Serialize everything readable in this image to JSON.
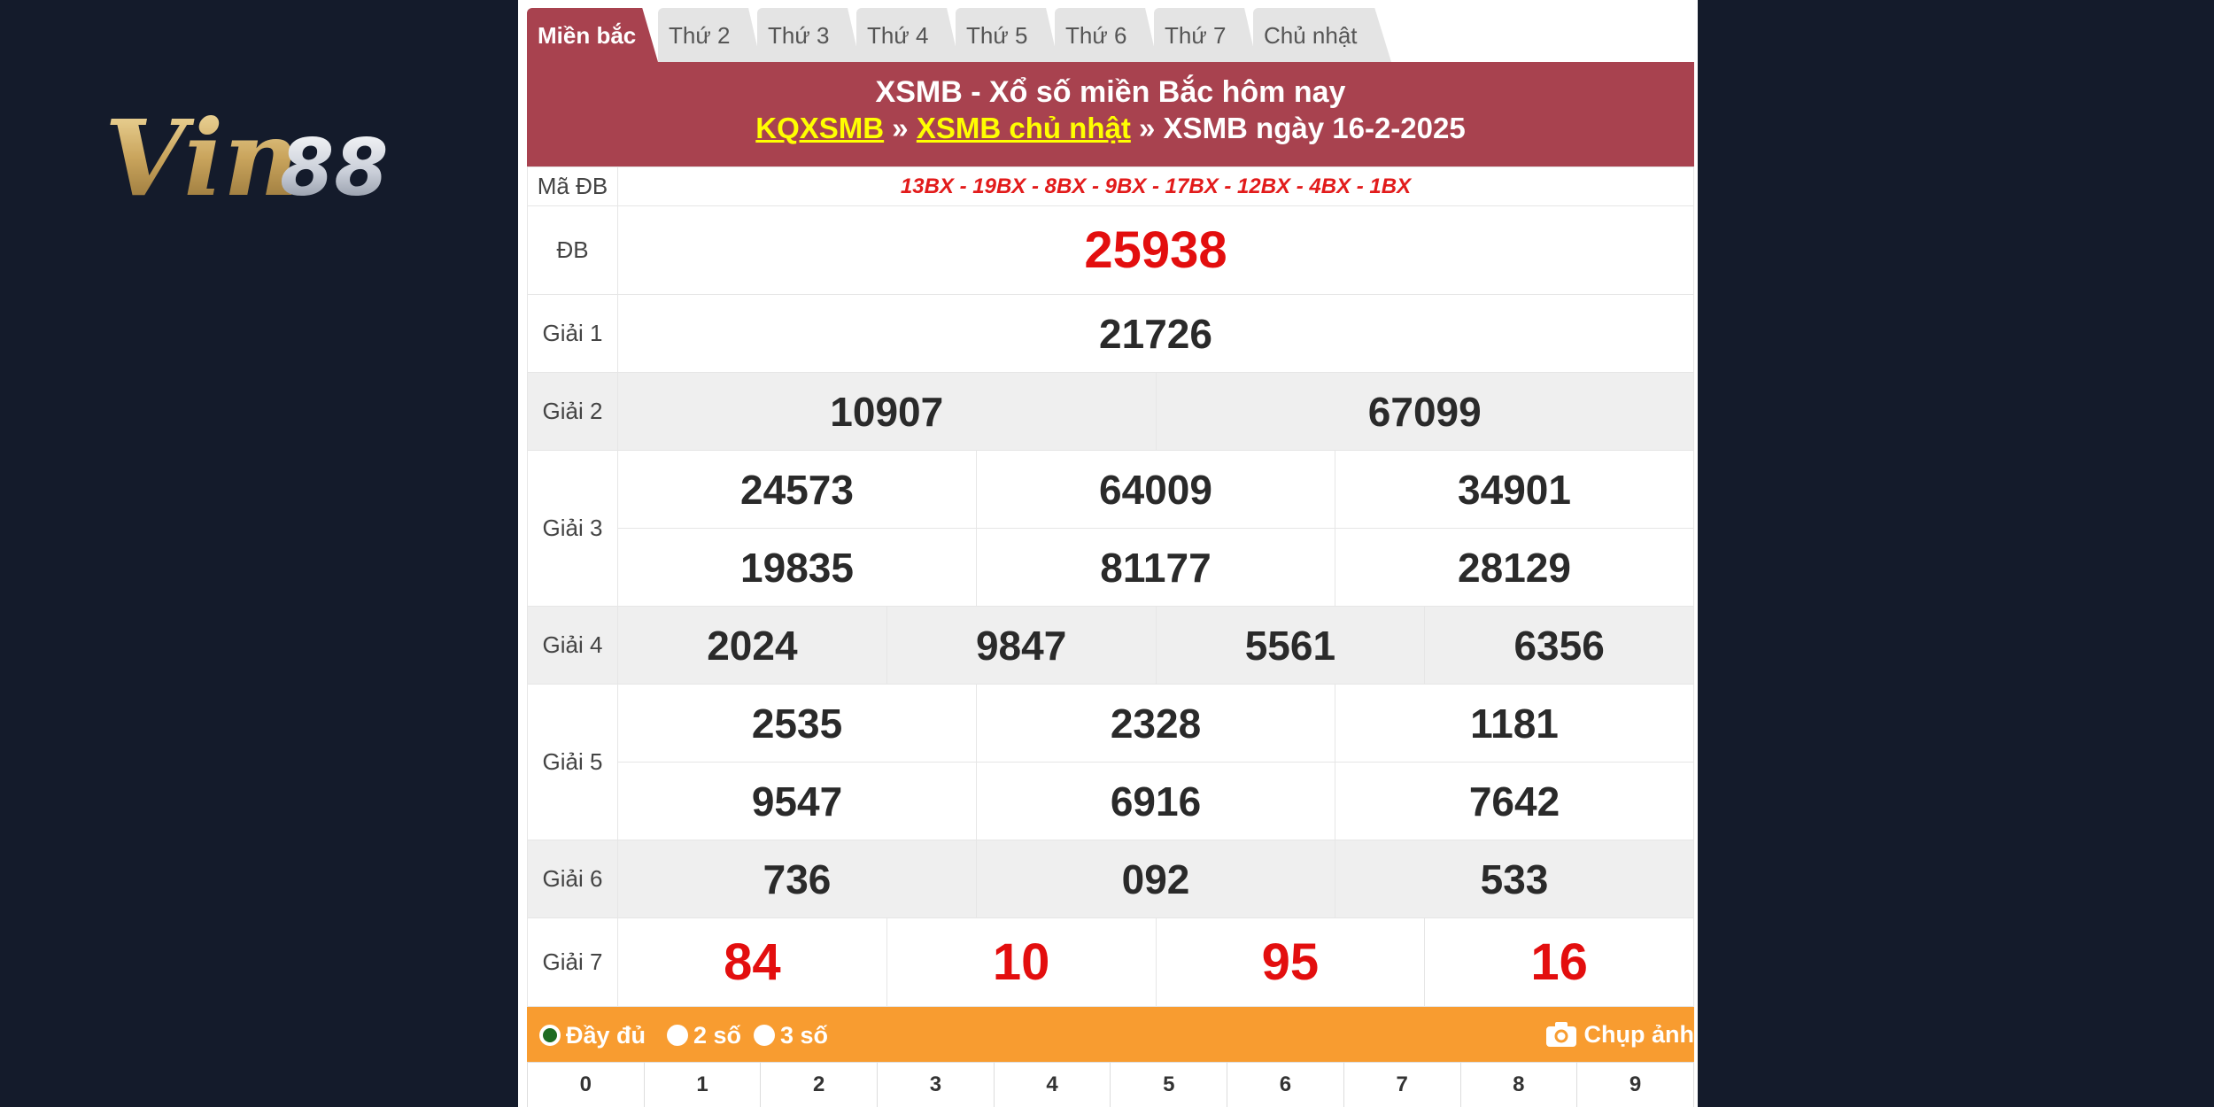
{
  "logo": {
    "text": "Vin88",
    "part1": "Vin",
    "part2": "88"
  },
  "tabs": [
    "Miền bắc",
    "Thứ 2",
    "Thứ 3",
    "Thứ 4",
    "Thứ 5",
    "Thứ 6",
    "Thứ 7",
    "Chủ nhật"
  ],
  "header": {
    "title": "XSMB - Xổ số miền Bắc hôm nay",
    "crumb1": "KQXSMB",
    "sep": " » ",
    "crumb2": "XSMB chủ nhật",
    "crumb3": "XSMB ngày 16-2-2025"
  },
  "results": {
    "ma_db_label": "Mã ĐB",
    "ma_db": "13BX - 19BX - 8BX - 9BX - 17BX - 12BX - 4BX - 1BX",
    "db_label": "ĐB",
    "db": "25938",
    "g1_label": "Giải 1",
    "g1": [
      "21726"
    ],
    "g2_label": "Giải 2",
    "g2": [
      "10907",
      "67099"
    ],
    "g3_label": "Giải 3",
    "g3": [
      "24573",
      "64009",
      "34901",
      "19835",
      "81177",
      "28129"
    ],
    "g4_label": "Giải 4",
    "g4": [
      "2024",
      "9847",
      "5561",
      "6356"
    ],
    "g5_label": "Giải 5",
    "g5": [
      "2535",
      "2328",
      "1181",
      "9547",
      "6916",
      "7642"
    ],
    "g6_label": "Giải 6",
    "g6": [
      "736",
      "092",
      "533"
    ],
    "g7_label": "Giải 7",
    "g7": [
      "84",
      "10",
      "95",
      "16"
    ]
  },
  "options": {
    "full": "Đầy đủ",
    "two": "2 số",
    "three": "3 số",
    "snapshot": "Chụp ảnh"
  },
  "digits": [
    "0",
    "1",
    "2",
    "3",
    "4",
    "5",
    "6",
    "7",
    "8",
    "9"
  ],
  "colors": {
    "accent": "#a8424f",
    "red": "#e30e0e",
    "orange": "#f89c30",
    "link": "#ffff00"
  },
  "icons": {
    "snapshot": "camera-icon"
  }
}
